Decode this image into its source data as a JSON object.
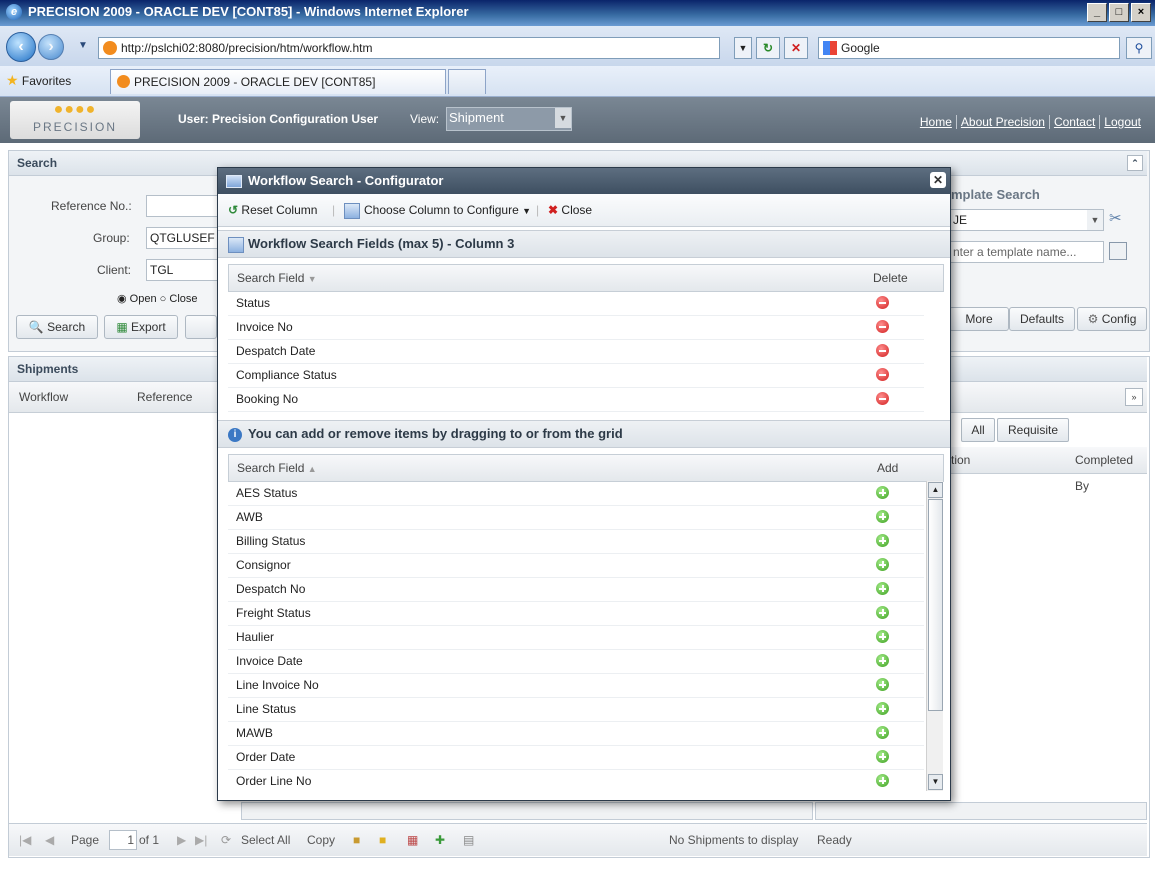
{
  "browser": {
    "title": "PRECISION 2009 - ORACLE DEV [CONT85] - Windows Internet Explorer",
    "url": "http://pslchi02:8080/precision/htm/workflow.htm",
    "search_engine": "Google",
    "favorites_label": "Favorites",
    "tab_title": "PRECISION 2009 - ORACLE DEV [CONT85]"
  },
  "app": {
    "logo_text": "PRECISION",
    "user_label": "User: Precision Configuration User",
    "view_label": "View:",
    "view_value": "Shipment",
    "links": [
      "Home",
      "About Precision",
      "Contact",
      "Logout"
    ]
  },
  "search_panel": {
    "title": "Search",
    "reference_label": "Reference No.:",
    "group_label": "Group:",
    "group_value": "QTGLUSEF",
    "client_label": "Client:",
    "client_value": "TGL",
    "radio_open": "Open",
    "radio_closed": "Close",
    "search_btn": "Search",
    "export_btn": "Export",
    "template_title": "mplate Search",
    "template_value": "JE",
    "template_placeholder": "nter a template name...",
    "more_btn": "More",
    "defaults_btn": "Defaults",
    "config_btn": "Config"
  },
  "shipments": {
    "title": "Shipments",
    "col_workflow": "Workflow",
    "col_reference": "Reference",
    "tab_all": "All",
    "tab_requisite": "Requisite",
    "col_tion": "tion",
    "col_completed_by": "Completed By"
  },
  "statusbar": {
    "page_label": "Page",
    "page_value": "1",
    "of_label": "of 1",
    "select_all": "Select All",
    "copy": "Copy",
    "no_shipments": "No Shipments to display",
    "ready": "Ready"
  },
  "modal": {
    "title": "Workflow Search - Configurator",
    "toolbar": {
      "reset": "Reset Column",
      "choose": "Choose Column to Configure",
      "close": "Close"
    },
    "section1_title": "Workflow Search Fields (max 5) - Column 3",
    "grid1_col_field": "Search Field",
    "grid1_col_delete": "Delete",
    "selected_fields": [
      "Status",
      "Invoice No",
      "Despatch Date",
      "Compliance Status",
      "Booking No"
    ],
    "section2_title": "You can add or remove items by dragging to or from the grid",
    "grid2_col_field": "Search Field",
    "grid2_col_add": "Add",
    "available_fields": [
      "AES Status",
      "AWB",
      "Billing Status",
      "Consignor",
      "Despatch No",
      "Freight Status",
      "Haulier",
      "Invoice Date",
      "Line Invoice No",
      "Line Status",
      "MAWB",
      "Order Date",
      "Order Line No"
    ]
  }
}
